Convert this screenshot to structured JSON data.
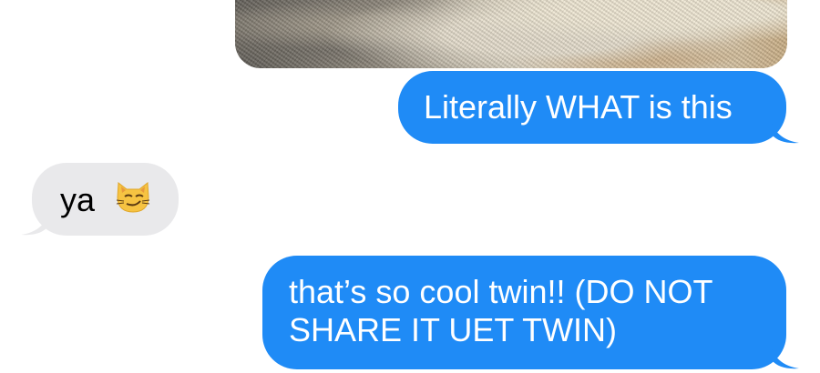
{
  "thread": {
    "messages": [
      {
        "direction": "sent",
        "type": "image",
        "content": "photo of fuzzy rug with cat"
      },
      {
        "direction": "sent",
        "text": "Literally WHAT is this"
      },
      {
        "direction": "received",
        "text": "ya",
        "emoji": "smirk-cat-icon"
      },
      {
        "direction": "sent",
        "text": "that’s so cool twin!! (DO NOT SHARE IT UET TWIN)"
      }
    ]
  },
  "colors": {
    "sent_bubble": "#1f8bf6",
    "received_bubble": "#e9e9eb",
    "background": "#ffffff"
  }
}
